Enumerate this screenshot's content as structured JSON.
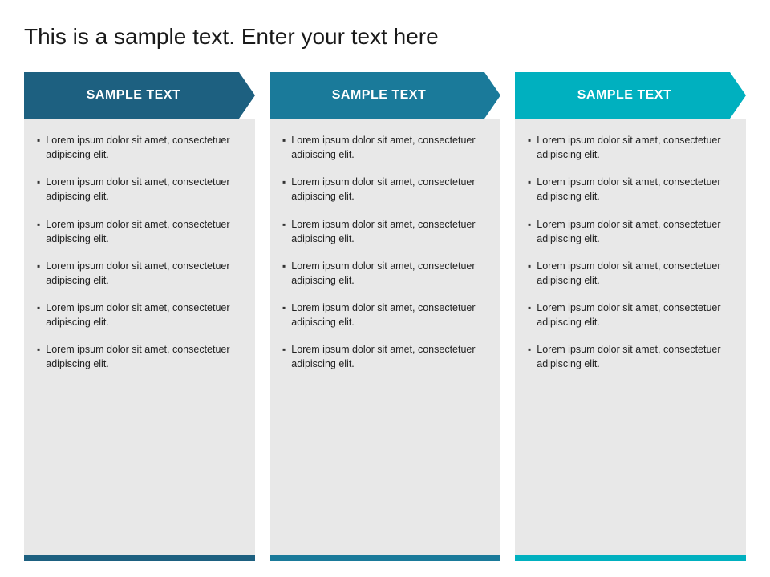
{
  "page": {
    "title": "This is a sample text. Enter your text here"
  },
  "columns": [
    {
      "id": "col-1",
      "header": "SAMPLE TEXT",
      "bullet_items": [
        "Lorem ipsum dolor sit amet, consectetuer adipiscing elit.",
        "Lorem ipsum dolor sit amet, consectetuer adipiscing elit.",
        "Lorem ipsum dolor sit amet, consectetuer adipiscing elit.",
        "Lorem ipsum dolor sit amet, consectetuer adipiscing elit.",
        "Lorem ipsum dolor sit amet, consectetuer adipiscing elit.",
        "Lorem ipsum dolor sit amet, consectetuer adipiscing elit."
      ]
    },
    {
      "id": "col-2",
      "header": "SAMPLE TEXT",
      "bullet_items": [
        "Lorem ipsum dolor sit amet, consectetuer adipiscing elit.",
        "Lorem ipsum dolor sit amet, consectetuer adipiscing elit.",
        "Lorem ipsum dolor sit amet, consectetuer adipiscing elit.",
        "Lorem ipsum dolor sit amet, consectetuer adipiscing elit.",
        "Lorem ipsum dolor sit amet, consectetuer adipiscing elit.",
        "Lorem ipsum dolor sit amet, consectetuer adipiscing elit."
      ]
    },
    {
      "id": "col-3",
      "header": "SAMPLE TEXT",
      "bullet_items": [
        "Lorem ipsum dolor sit amet, consectetuer adipiscing elit.",
        "Lorem ipsum dolor sit amet, consectetuer adipiscing elit.",
        "Lorem ipsum dolor sit amet, consectetuer adipiscing elit.",
        "Lorem ipsum dolor sit amet, consectetuer adipiscing elit.",
        "Lorem ipsum dolor sit amet, consectetuer adipiscing elit.",
        "Lorem ipsum dolor sit amet, consectetuer adipiscing elit."
      ]
    }
  ],
  "colors": {
    "col1_header": "#1d6080",
    "col2_header": "#1a7a9a",
    "col3_header": "#00b0bf",
    "body_bg": "#e8e8e8",
    "bullet_text": "#222222"
  }
}
